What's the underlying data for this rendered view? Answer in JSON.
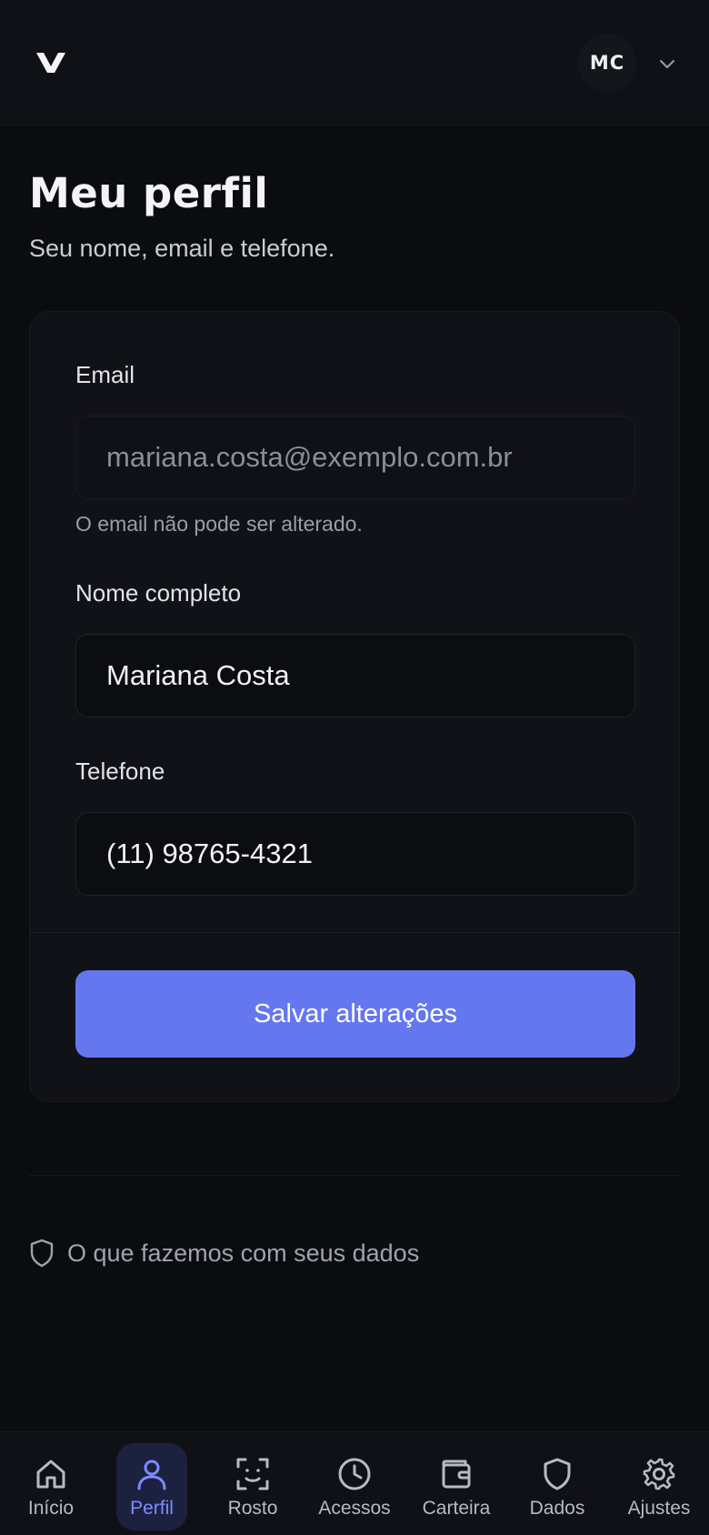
{
  "header": {
    "avatar_initials": "MC",
    "logo_icon": "v-logo-icon",
    "menu_icon": "chevron-down-icon"
  },
  "page": {
    "title": "Meu perfil",
    "subtitle": "Seu nome, email e telefone."
  },
  "form": {
    "email": {
      "label": "Email",
      "value": "mariana.costa@exemplo.com.br",
      "help": "O email não pode ser alterado."
    },
    "name": {
      "label": "Nome completo",
      "value": "Mariana Costa"
    },
    "phone": {
      "label": "Telefone",
      "value": "(11) 98765-4321"
    },
    "save_label": "Salvar alterações"
  },
  "privacy": {
    "label": "O que fazemos com seus dados",
    "icon": "shield-icon"
  },
  "nav": {
    "items": [
      {
        "label": "Início",
        "icon": "home-icon"
      },
      {
        "label": "Perfil",
        "icon": "user-icon",
        "active": true
      },
      {
        "label": "Rosto",
        "icon": "face-scan-icon"
      },
      {
        "label": "Acessos",
        "icon": "clock-icon"
      },
      {
        "label": "Carteira",
        "icon": "wallet-icon"
      },
      {
        "label": "Dados",
        "icon": "shield-icon"
      },
      {
        "label": "Ajustes",
        "icon": "gear-icon"
      }
    ]
  },
  "colors": {
    "background": "#0b0c10",
    "card": "#111218",
    "accent": "#6577ef",
    "active_nav": "#7d8cff"
  }
}
